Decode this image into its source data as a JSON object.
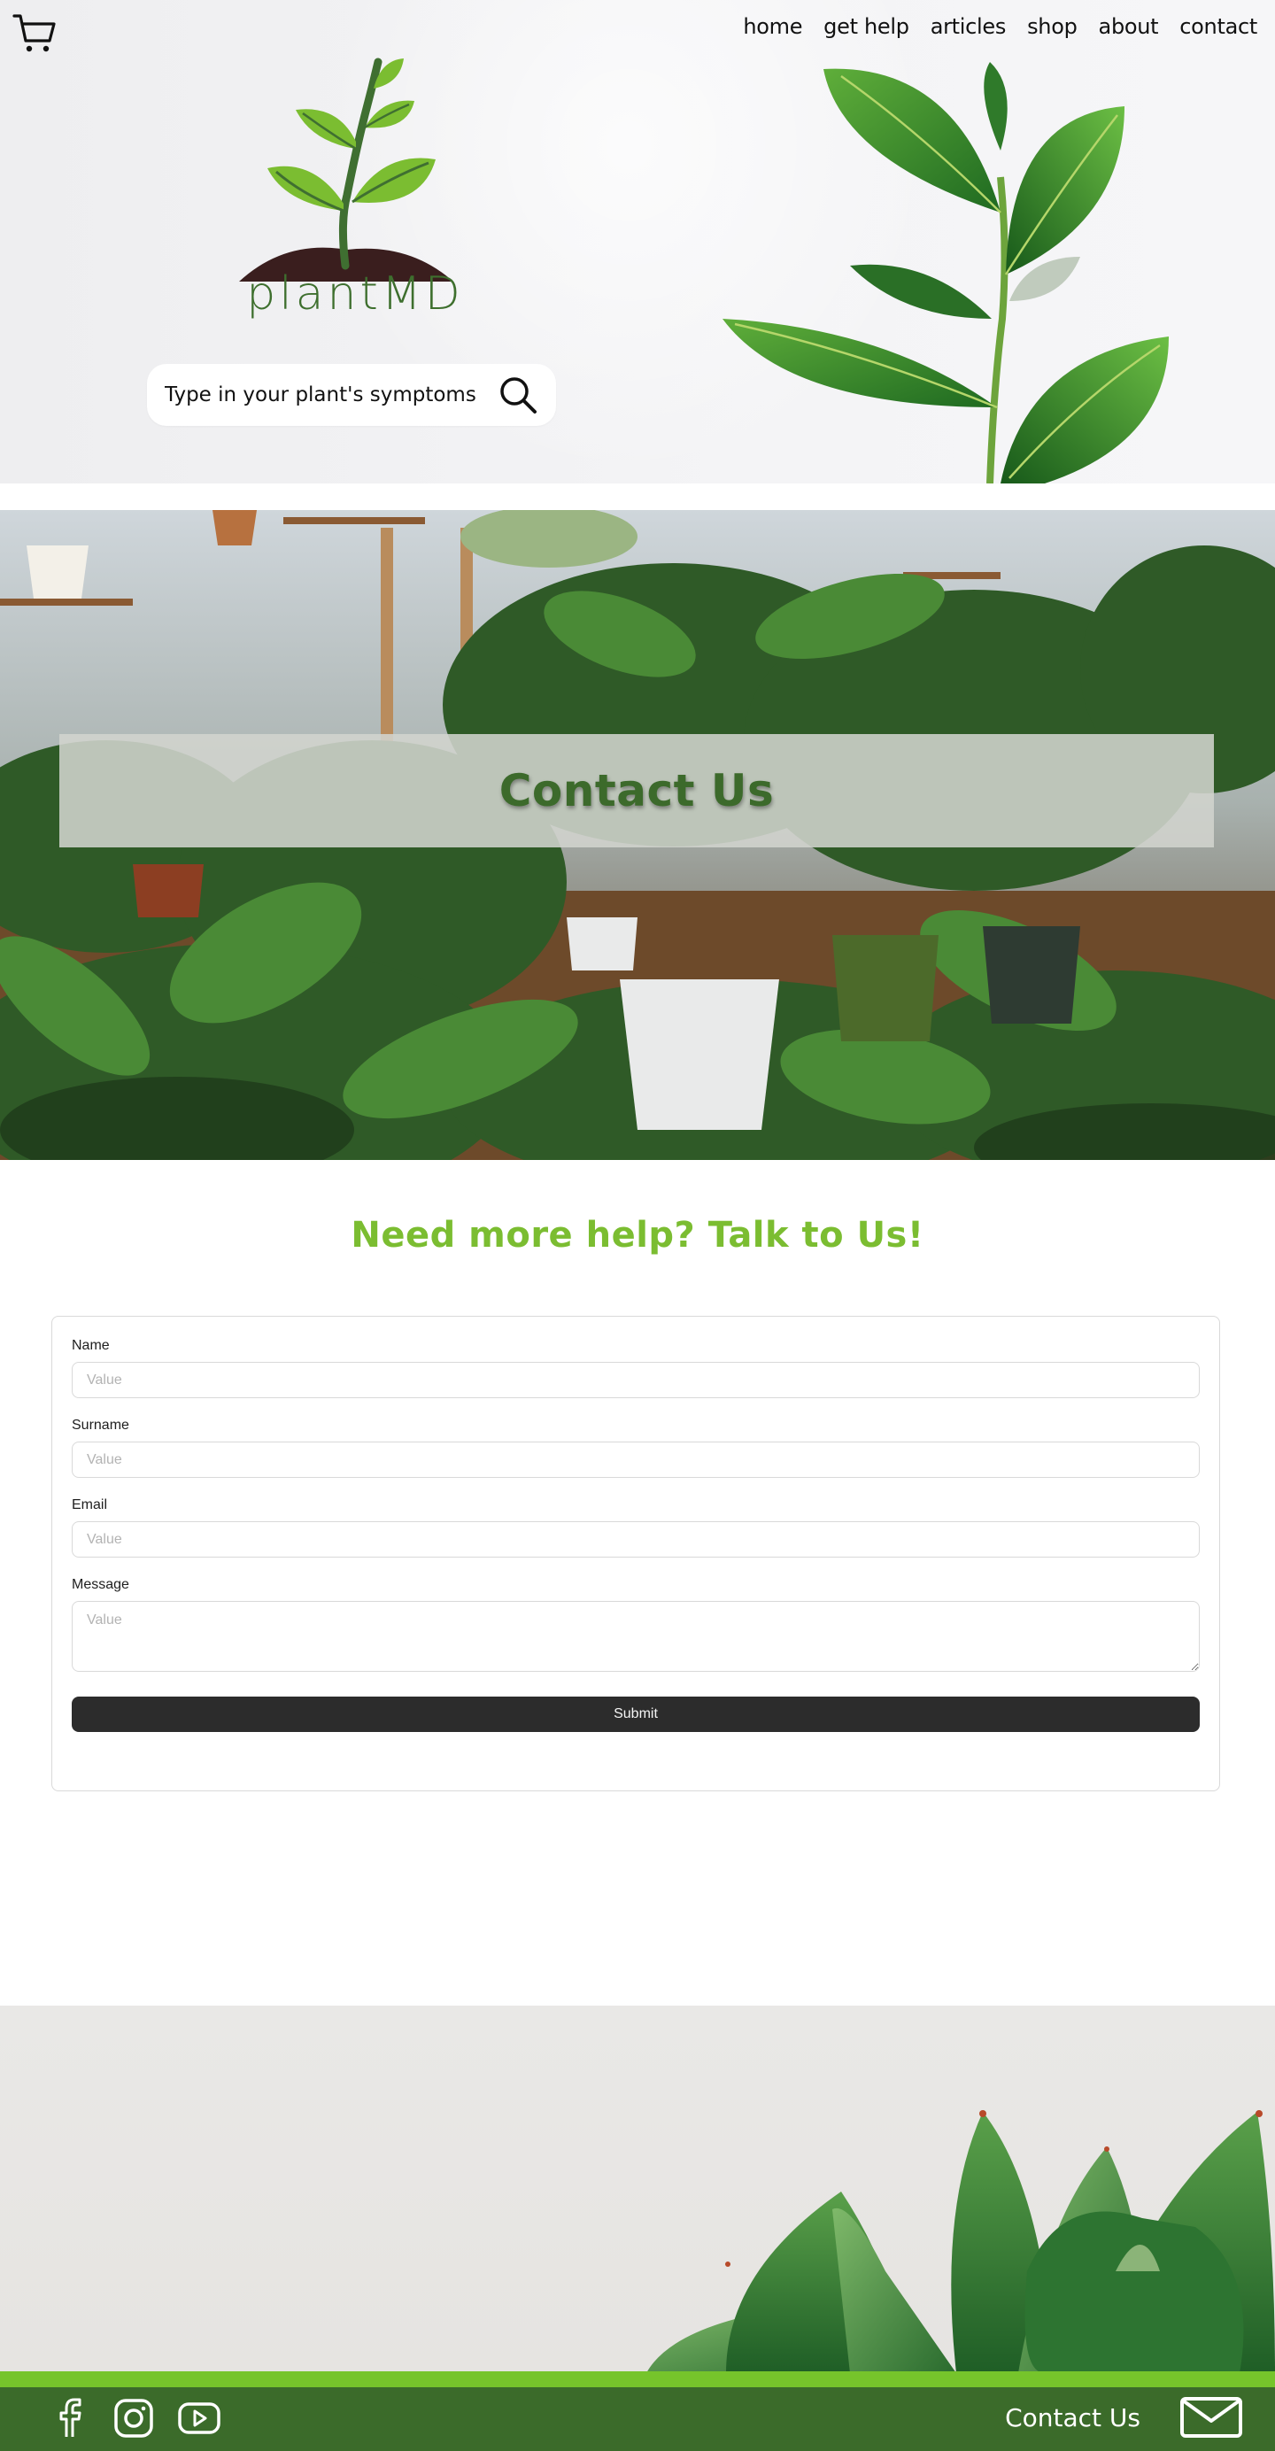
{
  "header": {
    "nav": [
      "home",
      "get help",
      "articles",
      "shop",
      "about",
      "contact"
    ],
    "brand": "plantMD",
    "search_placeholder": "Type in your plant's symptoms"
  },
  "banner": {
    "title": "Contact Us"
  },
  "form_section": {
    "title": "Need more help? Talk to Us!",
    "fields": [
      {
        "label": "Name",
        "placeholder": "Value"
      },
      {
        "label": "Surname",
        "placeholder": "Value"
      },
      {
        "label": "Email",
        "placeholder": "Value"
      },
      {
        "label": "Message",
        "placeholder": "Value"
      }
    ],
    "submit_label": "Submit"
  },
  "footer": {
    "contact_label": "Contact Us",
    "social": [
      "facebook-icon",
      "instagram-icon",
      "youtube-icon"
    ],
    "colors": {
      "bar": "#3b6b2a",
      "accent": "#76c42b"
    }
  },
  "colors": {
    "brand_green": "#3e6f2e",
    "title_green": "#7bbd31",
    "button_dark": "#2c2c2c"
  }
}
